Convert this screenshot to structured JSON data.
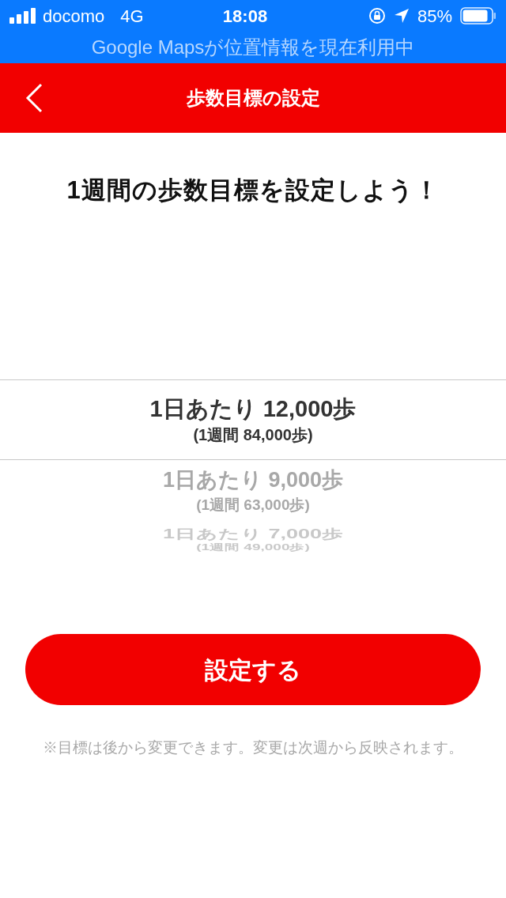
{
  "status_bar": {
    "carrier": "docomo",
    "network": "4G",
    "time": "18:08",
    "battery": "85%",
    "banner": "Google Mapsが位置情報を現在利用中"
  },
  "header": {
    "title": "歩数目標の設定"
  },
  "heading": "1週間の歩数目標を設定しよう！",
  "picker": {
    "options": [
      {
        "daily": "1日あたり 12,000歩",
        "weekly": "(1週間 84,000歩)",
        "selected": true
      },
      {
        "daily": "1日あたり 9,000歩",
        "weekly": "(1週間 63,000歩)",
        "selected": false
      },
      {
        "daily": "1日あたり 7,000歩",
        "weekly": "(1週間 49,000歩)",
        "selected": false
      }
    ]
  },
  "submit_button": "設定する",
  "note": "※目標は後から変更できます。変更は次週から反映されます。"
}
